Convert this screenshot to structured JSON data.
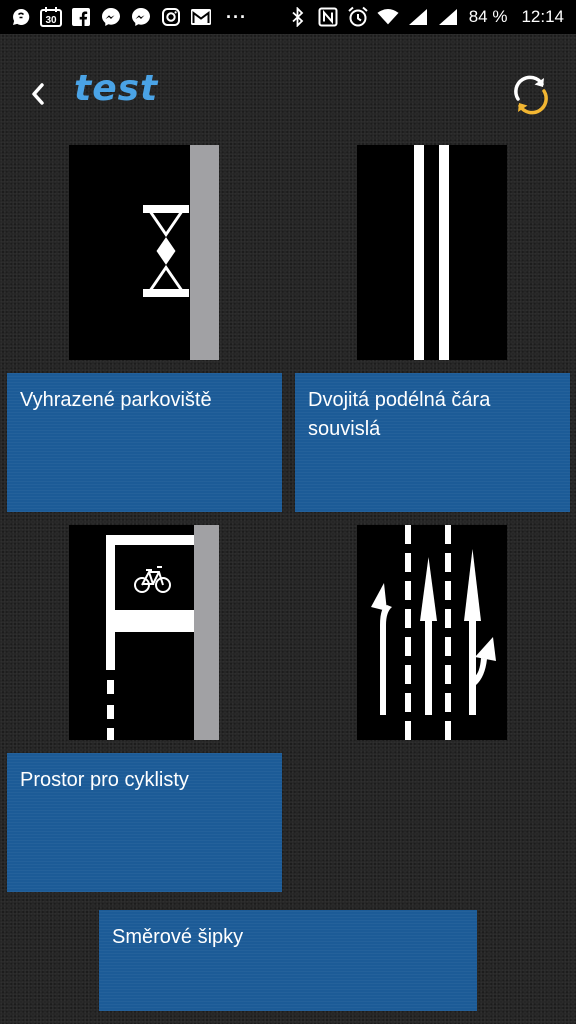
{
  "status_bar": {
    "battery_percent": "84 %",
    "time": "12:14",
    "overflow": "···",
    "calendar_day": "30",
    "icons": [
      "messaging-icon",
      "calendar-icon",
      "facebook-icon",
      "messenger-icon",
      "messenger-icon",
      "instagram-icon",
      "gmail-icon",
      "bluetooth-icon",
      "nfc-icon",
      "alarm-icon",
      "wifi-icon",
      "signal-icon",
      "signal-icon"
    ]
  },
  "header": {
    "title": "test",
    "back_icon": "chevron-left-icon",
    "refresh_icon": "refresh-icon",
    "title_color": "#4aa3e6",
    "refresh_color": "#f2b632"
  },
  "cards": [
    {
      "label": "Vyhrazené parkoviště",
      "image": "reserved-parking-marking"
    },
    {
      "label": "Dvojitá podélná čára souvislá",
      "image": "double-solid-line-marking"
    },
    {
      "label": "Prostor pro cyklisty",
      "image": "cyclist-area-marking"
    },
    {
      "label": "Směrové šipky",
      "image": "direction-arrows-marking"
    }
  ],
  "colors": {
    "label_background": "#1c5b97",
    "page_background": "#262626"
  }
}
